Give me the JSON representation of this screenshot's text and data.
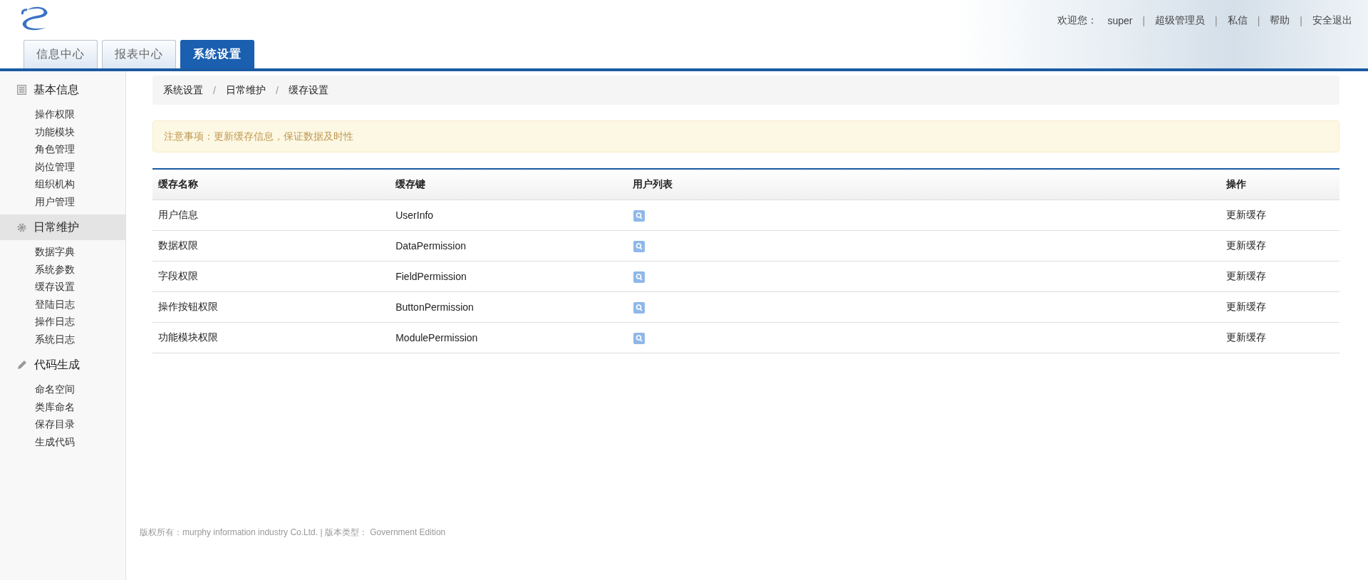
{
  "header": {
    "welcome_label": "欢迎您：",
    "username": "super",
    "links": [
      {
        "separator": "|",
        "label": "超级管理员"
      },
      {
        "separator": "|",
        "label": "私信"
      },
      {
        "separator": "|",
        "label": "帮助"
      },
      {
        "separator": "|",
        "label": "安全退出"
      }
    ]
  },
  "tabs": [
    {
      "label": "信息中心",
      "selected": false
    },
    {
      "label": "报表中心",
      "selected": false
    },
    {
      "label": "系统设置",
      "selected": true
    }
  ],
  "sidebar": {
    "groups": [
      {
        "label": "基本信息",
        "selected": false,
        "items": [
          "操作权限",
          "功能模块",
          "角色管理",
          "岗位管理",
          "组织机构",
          "用户管理"
        ]
      },
      {
        "label": "日常维护",
        "selected": true,
        "items": [
          "数据字典",
          "系统参数",
          "缓存设置",
          "登陆日志",
          "操作日志",
          "系统日志"
        ]
      },
      {
        "label": "代码生成",
        "selected": false,
        "items": [
          "命名空间",
          "类库命名",
          "保存目录",
          "生成代码"
        ]
      }
    ]
  },
  "breadcrumb": [
    {
      "label": "系统设置"
    },
    {
      "separator": "/",
      "label": "日常维护"
    },
    {
      "separator": "/",
      "label": "缓存设置"
    }
  ],
  "notice": "注意事项：更新缓存信息，保证数据及时性",
  "table": {
    "columns": [
      "缓存名称",
      "缓存键",
      "用户列表",
      "操作"
    ],
    "rows": [
      {
        "name": "用户信息",
        "key": "UserInfo",
        "action": "更新缓存"
      },
      {
        "name": "数据权限",
        "key": "DataPermission",
        "action": "更新缓存"
      },
      {
        "name": "字段权限",
        "key": "FieldPermission",
        "action": "更新缓存"
      },
      {
        "name": "操作按钮权限",
        "key": "ButtonPermission",
        "action": "更新缓存"
      },
      {
        "name": "功能模块权限",
        "key": "ModulePermission",
        "action": "更新缓存"
      }
    ]
  },
  "footer": "版权所有：murphy information industry Co.Ltd. | 版本类型： Government Edition"
}
